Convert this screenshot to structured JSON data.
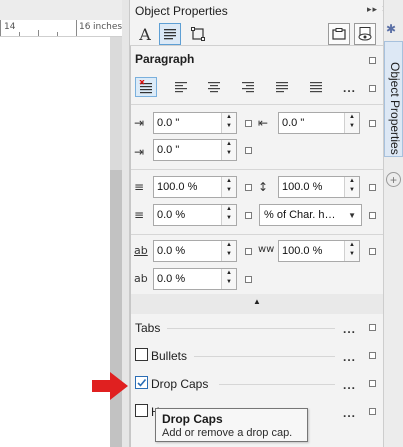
{
  "ruler": {
    "marks": [
      "14",
      "16"
    ],
    "unit": "inches"
  },
  "panel": {
    "title": "Object Properties",
    "title_controls": "▸▸ ✕"
  },
  "toolbar": {
    "icons": [
      "character-icon",
      "paragraph-icon",
      "frame-icon"
    ],
    "right_icons": [
      "frame-view-icon",
      "preview-icon"
    ]
  },
  "paragraph": {
    "section_title": "Paragraph",
    "alignment_more": "...",
    "indent_first_left": "0.0 \"",
    "indent_first_right": "0.0 \"",
    "indent_left": "0.0 \"",
    "before_paragraph": "100.0 %",
    "line_spacing": "100.0 %",
    "after_paragraph": "0.0 %",
    "spacing_unit": "% of Char. h…",
    "char_spacing": "0.0 %",
    "word_spacing": "100.0 %",
    "language_spacing": "0.0 %"
  },
  "sections": {
    "tabs_label": "Tabs",
    "bullets_label": "Bullets",
    "drop_caps_label": "Drop Caps",
    "hyphenation_label": "H",
    "more": "..."
  },
  "tooltip": {
    "title": "Drop Caps",
    "body": "Add or remove a drop cap."
  },
  "vertical_tab": {
    "label": "Object Properties"
  },
  "colors": {
    "accent": "#2a6db5",
    "arrow": "#e02020"
  }
}
